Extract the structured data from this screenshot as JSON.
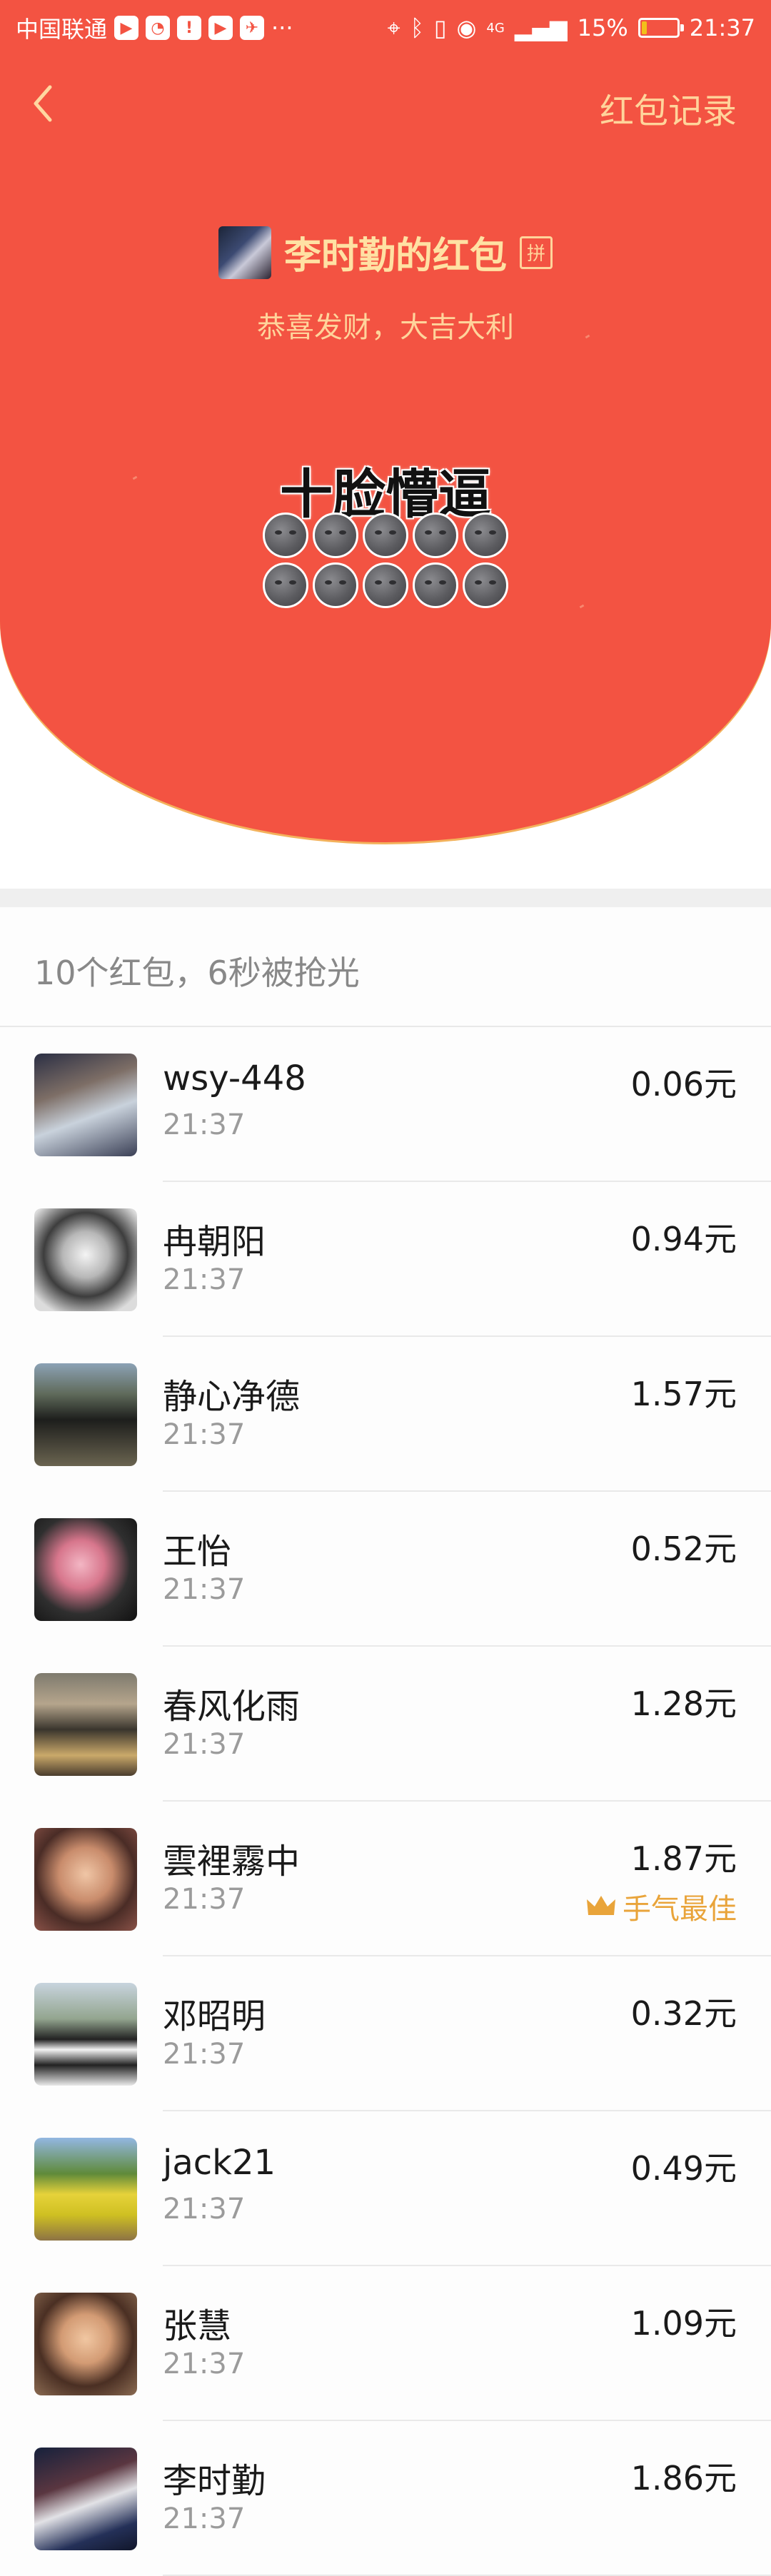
{
  "status_bar": {
    "carrier": "中国联通",
    "battery": "15%",
    "battery_level": 0.15,
    "time": "21:37",
    "network": "4G"
  },
  "nav": {
    "back_icon": "chevron-left-icon",
    "records_link": "红包记录"
  },
  "header": {
    "sender_name": "李时勤的红包",
    "pin_badge": "拼",
    "blessing": "恭喜发财，大吉大利",
    "packet_title": "十脸懵逼",
    "emoji_count": 10,
    "background_color": "#f35342",
    "accent_color": "#ffd49b"
  },
  "summary": "10个红包，6秒被抢光",
  "records": [
    {
      "name": "wsy-448",
      "time": "21:37",
      "amount": "0.06元",
      "best": false
    },
    {
      "name": "冉朝阳",
      "time": "21:37",
      "amount": "0.94元",
      "best": false
    },
    {
      "name": "静心净德",
      "time": "21:37",
      "amount": "1.57元",
      "best": false
    },
    {
      "name": "王怡",
      "time": "21:37",
      "amount": "0.52元",
      "best": false
    },
    {
      "name": "春风化雨",
      "time": "21:37",
      "amount": "1.28元",
      "best": false
    },
    {
      "name": "雲裡霧中",
      "time": "21:37",
      "amount": "1.87元",
      "best": true
    },
    {
      "name": "邓昭明",
      "time": "21:37",
      "amount": "0.32元",
      "best": false
    },
    {
      "name": "jack21",
      "time": "21:37",
      "amount": "0.49元",
      "best": false
    },
    {
      "name": "张慧",
      "time": "21:37",
      "amount": "1.09元",
      "best": false
    },
    {
      "name": "李时勤",
      "time": "21:37",
      "amount": "1.86元",
      "best": false
    }
  ],
  "best_label": "手气最佳",
  "best_color": "#e9a43a"
}
